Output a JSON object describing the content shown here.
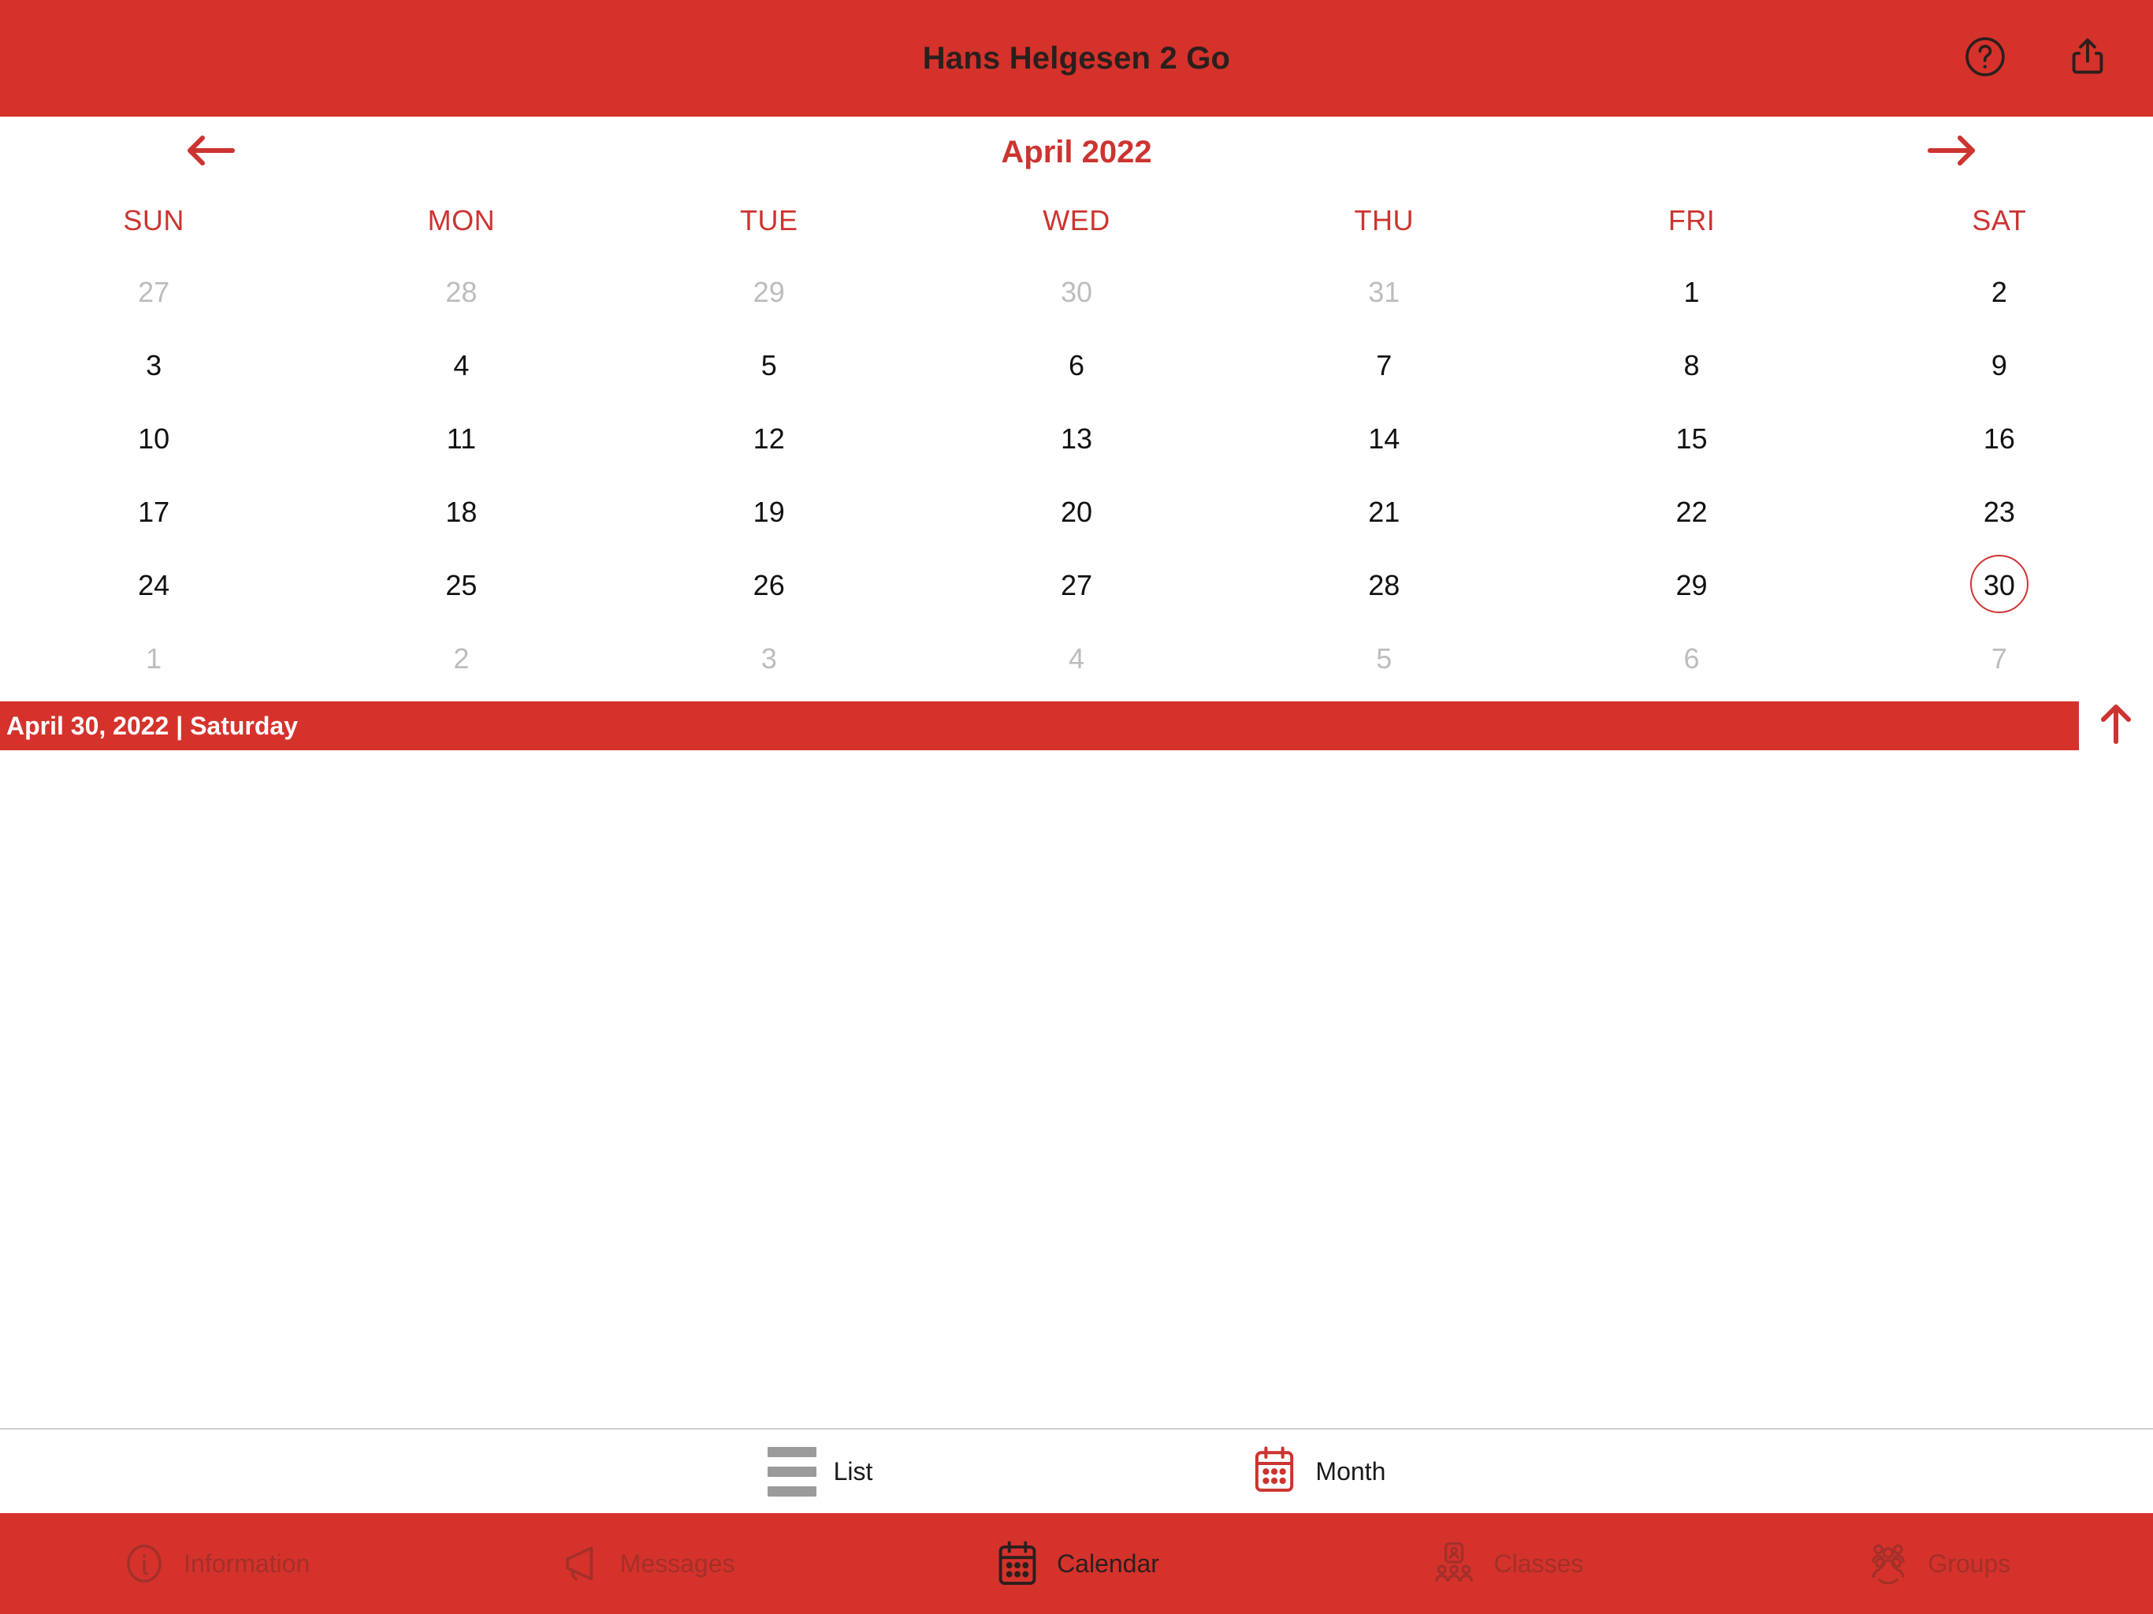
{
  "header": {
    "title": "Hans Helgesen 2 Go",
    "help_icon": "question-circle-icon",
    "share_icon": "share-icon",
    "background_color": "#d5322c",
    "title_color": "#2b1f1d"
  },
  "calendar": {
    "month_label": "April 2022",
    "prev_icon": "arrow-left-icon",
    "next_icon": "arrow-right-icon",
    "accent_color": "#cc3430",
    "weekdays": [
      "SUN",
      "MON",
      "TUE",
      "WED",
      "THU",
      "FRI",
      "SAT"
    ],
    "weeks": [
      [
        {
          "day": "27",
          "muted": true,
          "selected": false
        },
        {
          "day": "28",
          "muted": true,
          "selected": false
        },
        {
          "day": "29",
          "muted": true,
          "selected": false
        },
        {
          "day": "30",
          "muted": true,
          "selected": false
        },
        {
          "day": "31",
          "muted": true,
          "selected": false
        },
        {
          "day": "1",
          "muted": false,
          "selected": false
        },
        {
          "day": "2",
          "muted": false,
          "selected": false
        }
      ],
      [
        {
          "day": "3",
          "muted": false,
          "selected": false
        },
        {
          "day": "4",
          "muted": false,
          "selected": false
        },
        {
          "day": "5",
          "muted": false,
          "selected": false
        },
        {
          "day": "6",
          "muted": false,
          "selected": false
        },
        {
          "day": "7",
          "muted": false,
          "selected": false
        },
        {
          "day": "8",
          "muted": false,
          "selected": false
        },
        {
          "day": "9",
          "muted": false,
          "selected": false
        }
      ],
      [
        {
          "day": "10",
          "muted": false,
          "selected": false
        },
        {
          "day": "11",
          "muted": false,
          "selected": false
        },
        {
          "day": "12",
          "muted": false,
          "selected": false
        },
        {
          "day": "13",
          "muted": false,
          "selected": false
        },
        {
          "day": "14",
          "muted": false,
          "selected": false
        },
        {
          "day": "15",
          "muted": false,
          "selected": false
        },
        {
          "day": "16",
          "muted": false,
          "selected": false
        }
      ],
      [
        {
          "day": "17",
          "muted": false,
          "selected": false
        },
        {
          "day": "18",
          "muted": false,
          "selected": false
        },
        {
          "day": "19",
          "muted": false,
          "selected": false
        },
        {
          "day": "20",
          "muted": false,
          "selected": false
        },
        {
          "day": "21",
          "muted": false,
          "selected": false
        },
        {
          "day": "22",
          "muted": false,
          "selected": false
        },
        {
          "day": "23",
          "muted": false,
          "selected": false
        }
      ],
      [
        {
          "day": "24",
          "muted": false,
          "selected": false
        },
        {
          "day": "25",
          "muted": false,
          "selected": false
        },
        {
          "day": "26",
          "muted": false,
          "selected": false
        },
        {
          "day": "27",
          "muted": false,
          "selected": false
        },
        {
          "day": "28",
          "muted": false,
          "selected": false
        },
        {
          "day": "29",
          "muted": false,
          "selected": false
        },
        {
          "day": "30",
          "muted": false,
          "selected": true
        }
      ],
      [
        {
          "day": "1",
          "muted": true,
          "selected": false
        },
        {
          "day": "2",
          "muted": true,
          "selected": false
        },
        {
          "day": "3",
          "muted": true,
          "selected": false
        },
        {
          "day": "4",
          "muted": true,
          "selected": false
        },
        {
          "day": "5",
          "muted": true,
          "selected": false
        },
        {
          "day": "6",
          "muted": true,
          "selected": false
        },
        {
          "day": "7",
          "muted": true,
          "selected": false
        }
      ]
    ]
  },
  "selected_day_bar": {
    "text": "April 30, 2022 | Saturday",
    "collapse_icon": "arrow-up-icon",
    "background_color": "#d5322c",
    "text_color": "#ffffff"
  },
  "view_toggle": {
    "options": [
      {
        "label": "List",
        "icon": "list-icon",
        "active": false
      },
      {
        "label": "Month",
        "icon": "calendar-icon",
        "active": true
      }
    ],
    "active_color": "#cc3430",
    "inactive_color": "#9b9b9b"
  },
  "tabbar": {
    "background_color": "#d5322c",
    "active_color": "#2b1f1d",
    "inactive_color": "#a33029",
    "tabs": [
      {
        "label": "Information",
        "icon": "info-circle-icon",
        "active": false
      },
      {
        "label": "Messages",
        "icon": "megaphone-icon",
        "active": false
      },
      {
        "label": "Calendar",
        "icon": "calendar-icon",
        "active": true
      },
      {
        "label": "Classes",
        "icon": "classes-icon",
        "active": false
      },
      {
        "label": "Groups",
        "icon": "groups-icon",
        "active": false
      }
    ]
  }
}
